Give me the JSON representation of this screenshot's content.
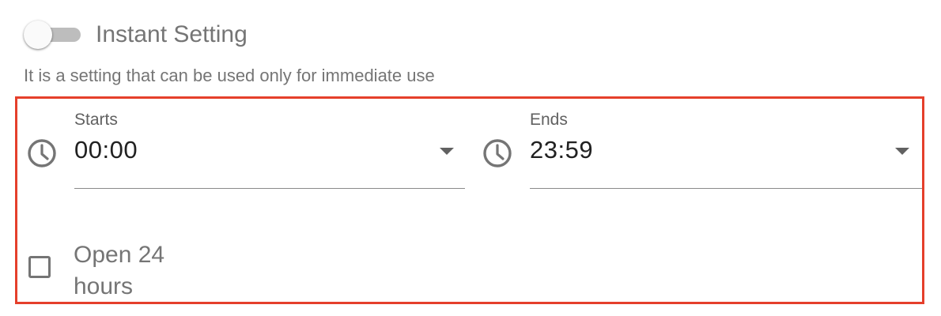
{
  "instant_setting": {
    "label": "Instant Setting",
    "enabled": false,
    "helper_text": "It is a setting that can be used only for immediate use"
  },
  "hours": {
    "highlight_color": "#e53f2b",
    "starts": {
      "label": "Starts",
      "value": "00:00",
      "icon": "clock-icon"
    },
    "ends": {
      "label": "Ends",
      "value": "23:59",
      "icon": "clock-icon"
    },
    "open_24_hours": {
      "label": "Open 24 hours",
      "checked": false
    }
  }
}
